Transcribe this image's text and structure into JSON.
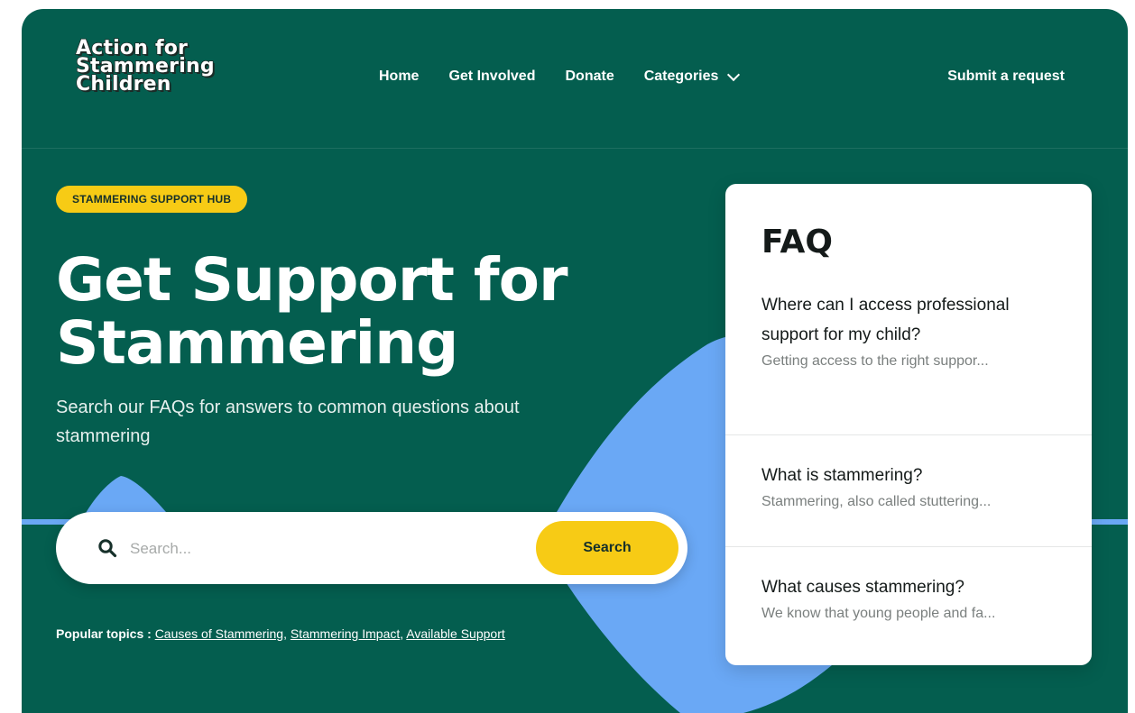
{
  "brand": {
    "logo_lines": [
      "Action for",
      "Stammering",
      "Children"
    ]
  },
  "nav": {
    "items": [
      "Home",
      "Get Involved",
      "Donate",
      "Categories"
    ],
    "submit_request": "Submit a request"
  },
  "hero": {
    "badge": "STAMMERING SUPPORT HUB",
    "title": "Get Support for Stammering",
    "subtitle": "Search our FAQs for answers to common questions about stammering"
  },
  "search": {
    "placeholder": "Search...",
    "button_label": "Search"
  },
  "popular": {
    "label": "Popular topics :",
    "links": [
      "Causes of Stammering",
      "Stammering Impact",
      "Available Support"
    ]
  },
  "faq": {
    "title": "FAQ",
    "items": [
      {
        "question": "Where can I access professional support for my child?",
        "answer": "Getting access to the right suppor..."
      },
      {
        "question": "What is stammering?",
        "answer": "Stammering, also called stuttering..."
      },
      {
        "question": "What causes stammering?",
        "answer": "We know that young people and fa..."
      }
    ]
  },
  "colors": {
    "background": "#045e4f",
    "accent_yellow": "#f7cb15",
    "decor_blue": "#6aa8f5"
  },
  "icons": {
    "search": "search-icon",
    "dropdown": "chevron-down-icon"
  }
}
